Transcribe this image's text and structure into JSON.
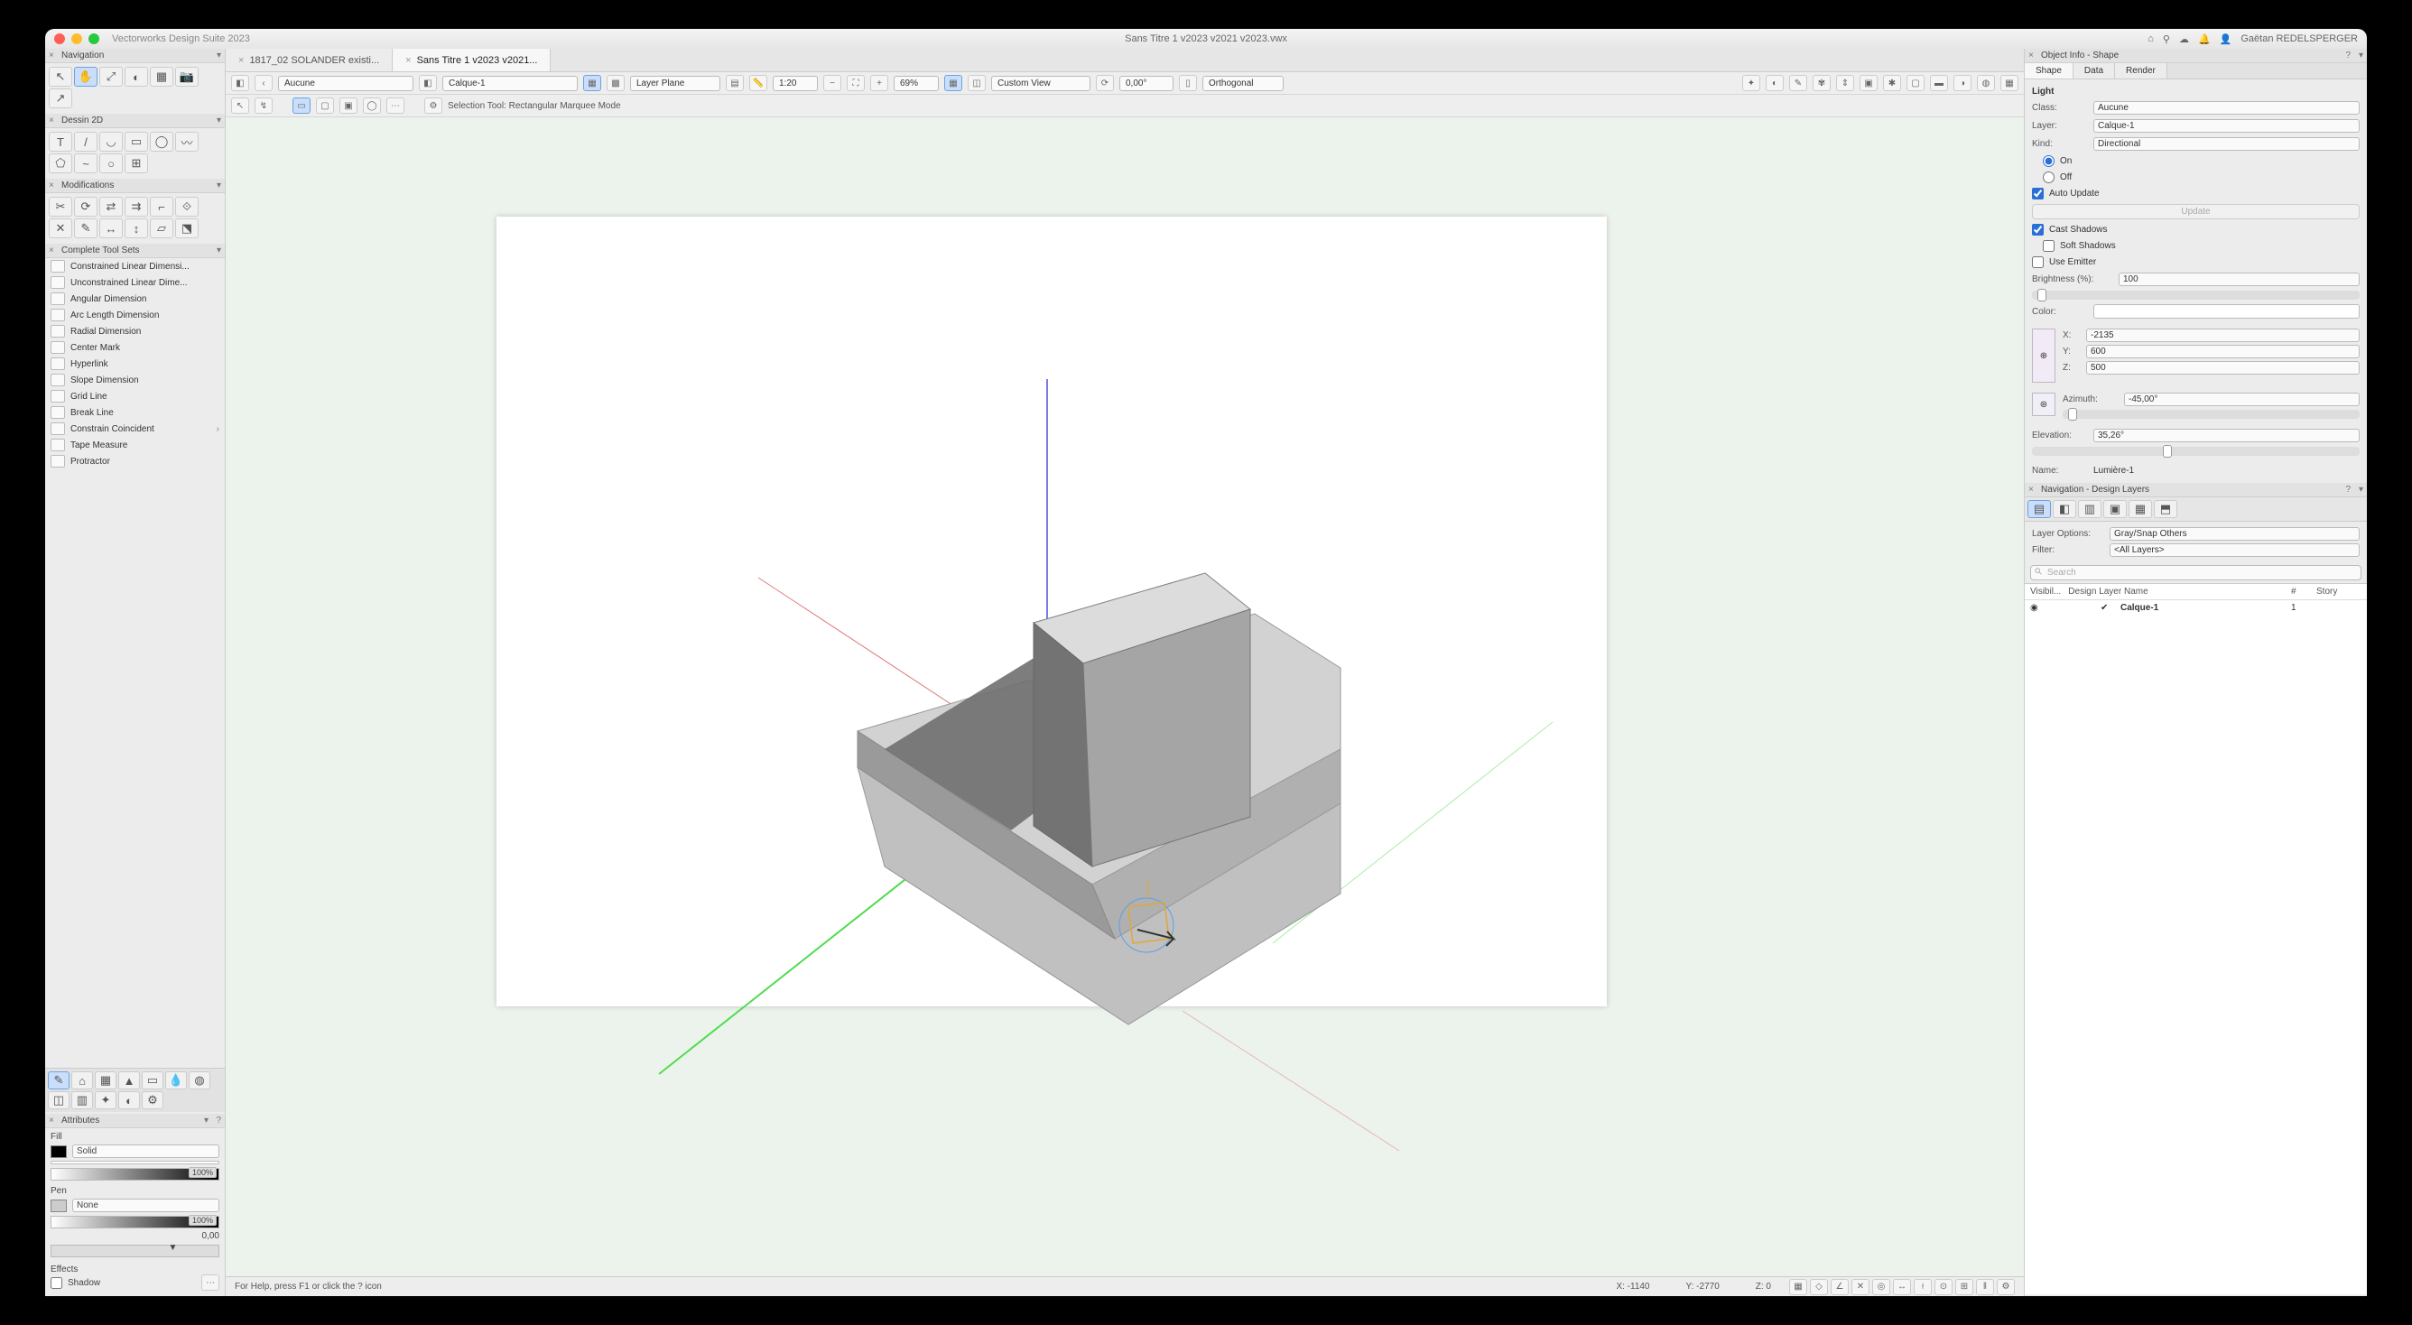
{
  "app": {
    "name": "Vectorworks Design Suite 2023",
    "document": "Sans Titre 1 v2023 v2021 v2023.vwx",
    "user": "Gaëtan REDELSPERGER"
  },
  "tabs": [
    {
      "label": "1817_02 SOLANDER existi...",
      "active": false
    },
    {
      "label": "Sans Titre 1 v2023 v2021...",
      "active": true
    }
  ],
  "palettes": {
    "navigation": {
      "title": "Navigation"
    },
    "dessin2d": {
      "title": "Dessin 2D"
    },
    "modifications": {
      "title": "Modifications"
    },
    "toolsets": {
      "title": "Complete Tool Sets",
      "items": [
        "Constrained Linear Dimensi...",
        "Unconstrained Linear Dime...",
        "Angular Dimension",
        "Arc Length Dimension",
        "Radial Dimension",
        "Center Mark",
        "Hyperlink",
        "Slope Dimension",
        "Grid Line",
        "Break Line",
        "Constrain Coincident",
        "Tape Measure",
        "Protractor"
      ]
    },
    "attributes": {
      "title": "Attributes",
      "fill_label": "Fill",
      "fill_mode": "Solid",
      "pen_label": "Pen",
      "pen_mode": "None",
      "effects": "Effects",
      "shadow": "Shadow",
      "opacity": "100%",
      "thickness": "0,00"
    }
  },
  "classbar": {
    "class_label": "Aucune",
    "layer_label": "Calque-1",
    "plane": "Layer Plane",
    "scale": "1:20",
    "zoom": "69%",
    "view": "Custom View",
    "angle": "0,00°",
    "projection": "Orthogonal"
  },
  "modebar": {
    "tool_hint": "Selection Tool: Rectangular Marquee Mode"
  },
  "statusbar": {
    "help": "For Help, press F1 or click the ? icon",
    "x": "X: -1140",
    "y": "Y: -2770",
    "z": "Z: 0"
  },
  "obj_info": {
    "title": "Object Info - Shape",
    "tabs": [
      "Shape",
      "Data",
      "Render"
    ],
    "section": "Light",
    "class": "Aucune",
    "layer": "Calque-1",
    "kind": "Directional",
    "on": "On",
    "off": "Off",
    "auto_update": "Auto Update",
    "update_btn": "Update",
    "cast": "Cast Shadows",
    "soft": "Soft Shadows",
    "emitter": "Use Emitter",
    "brightness_label": "Brightness (%):",
    "brightness": "100",
    "color_label": "Color:",
    "x_label": "X:",
    "x": "-2135",
    "y_label": "Y:",
    "y": "600",
    "z_label": "Z:",
    "z": "500",
    "azimuth_label": "Azimuth:",
    "azimuth": "-45,00°",
    "elevation_label": "Elevation:",
    "elevation": "35,26°",
    "name_label": "Name:",
    "name": "Lumière-1"
  },
  "nav_panel": {
    "title": "Navigation - Design Layers",
    "layer_options_label": "Layer Options:",
    "layer_options": "Gray/Snap Others",
    "filter_label": "Filter:",
    "filter": "<All Layers>",
    "search_ph": "Search",
    "cols": {
      "vis": "Visibil...",
      "name": "Design Layer Name",
      "num": "#",
      "story": "Story"
    },
    "rows": [
      {
        "name": "Calque-1",
        "num": "1"
      }
    ]
  }
}
